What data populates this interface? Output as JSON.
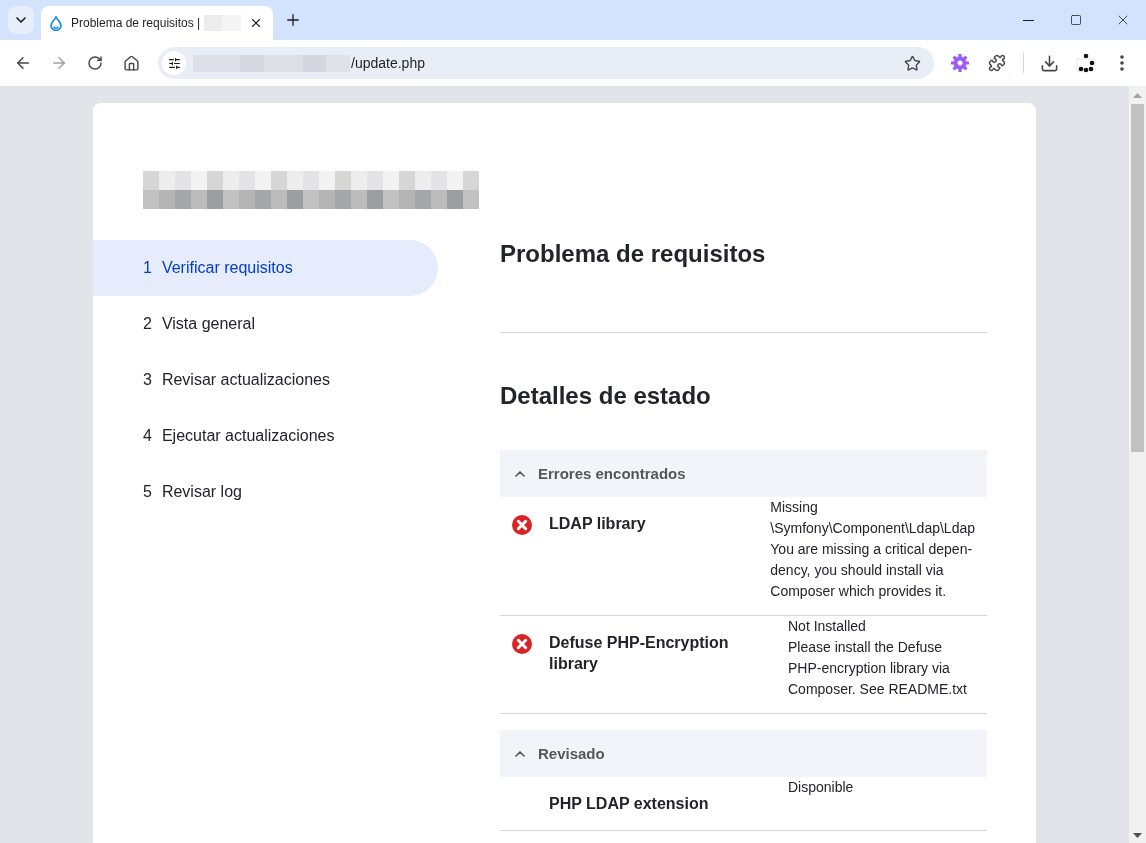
{
  "browser": {
    "tabs": [
      {
        "title": "Problema de requisitos |",
        "selected": true
      }
    ],
    "address": {
      "path": "/update.php"
    }
  },
  "sidebar": {
    "steps": [
      {
        "number": "1",
        "label": "Verificar requisitos",
        "selected": true
      },
      {
        "number": "2",
        "label": "Vista general",
        "selected": false
      },
      {
        "number": "3",
        "label": "Revisar actualizaciones",
        "selected": false
      },
      {
        "number": "4",
        "label": "Ejecutar actualizaciones",
        "selected": false
      },
      {
        "number": "5",
        "label": "Revisar log",
        "selected": false
      }
    ]
  },
  "main": {
    "title": "Problema de requisitos",
    "section_title": "Detalles de estado",
    "groups": [
      {
        "title": "Errores encontrados",
        "expanded": true,
        "items": [
          {
            "kind": "error",
            "title": "LDAP library",
            "value_lines": [
              "Missing",
              "\\Symfony\\Component\\Ldap\\Ldap"
            ],
            "description_lines": [
              "You are missing a critical depen-",
              "dency, you should install via",
              "Composer which provides it."
            ]
          },
          {
            "kind": "error",
            "title": "Defuse PHP-Encryption library",
            "value_lines": [
              "Not Installed"
            ],
            "description_lines": [
              "Please install the Defuse",
              "PHP-encryption library via",
              "Composer. See README.txt"
            ]
          }
        ]
      },
      {
        "title": "Revisado",
        "expanded": true,
        "items": [
          {
            "kind": "ok",
            "title": "PHP LDAP extension",
            "value_lines": [
              "Disponible"
            ]
          }
        ]
      }
    ]
  }
}
